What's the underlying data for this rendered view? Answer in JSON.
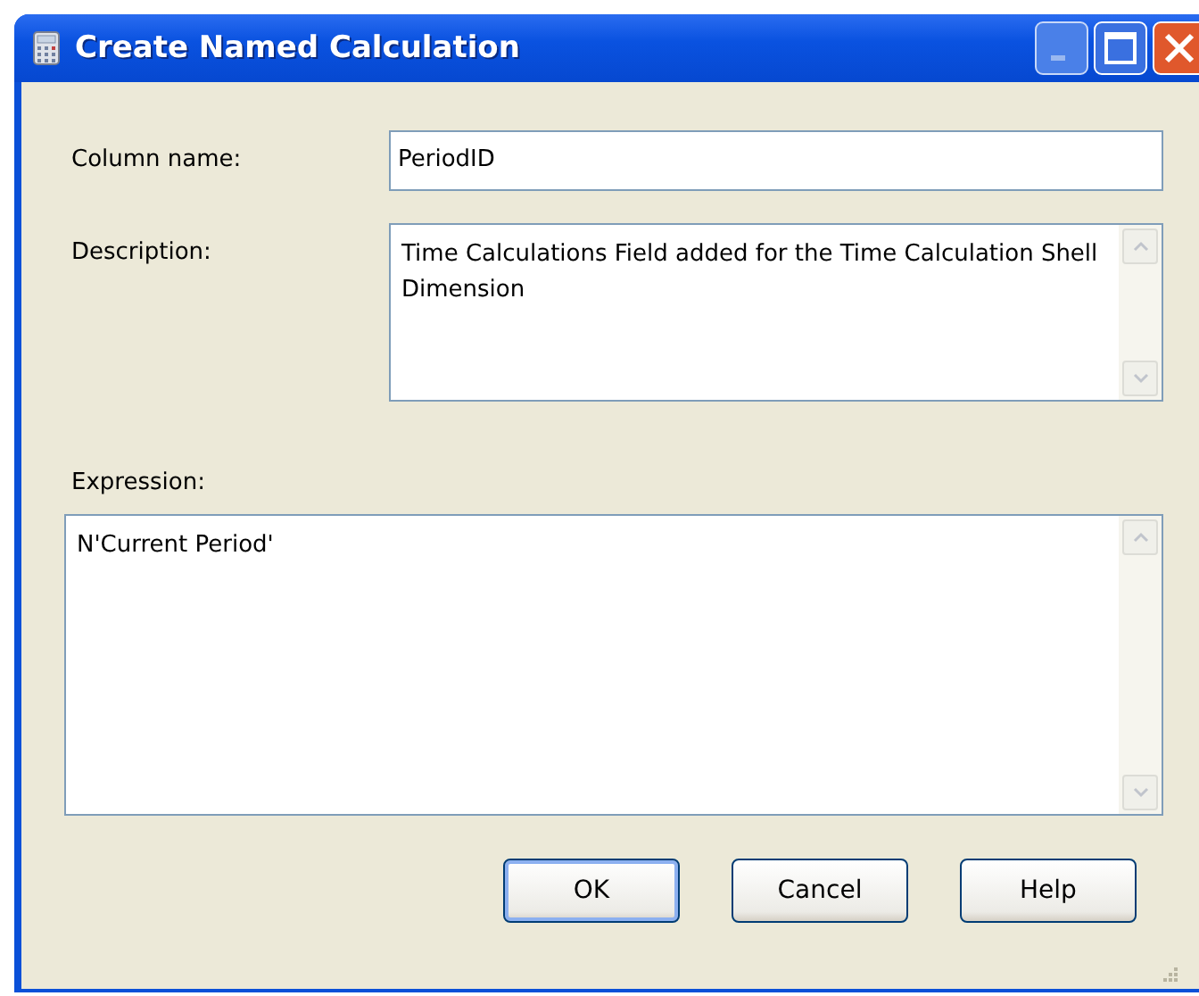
{
  "window": {
    "title": "Create Named Calculation"
  },
  "fields": [
    {
      "kind": "line",
      "label": "Column name:",
      "value": "PeriodID"
    },
    {
      "kind": "area",
      "label": "Description:",
      "value": "Time Calculations Field added for the Time Calculation Shell Dimension"
    }
  ],
  "expression": {
    "label": "Expression:",
    "value": "N'Current Period'"
  },
  "buttons": [
    {
      "label": "OK",
      "default": true
    },
    {
      "label": "Cancel",
      "default": false
    },
    {
      "label": "Help",
      "default": false
    }
  ]
}
